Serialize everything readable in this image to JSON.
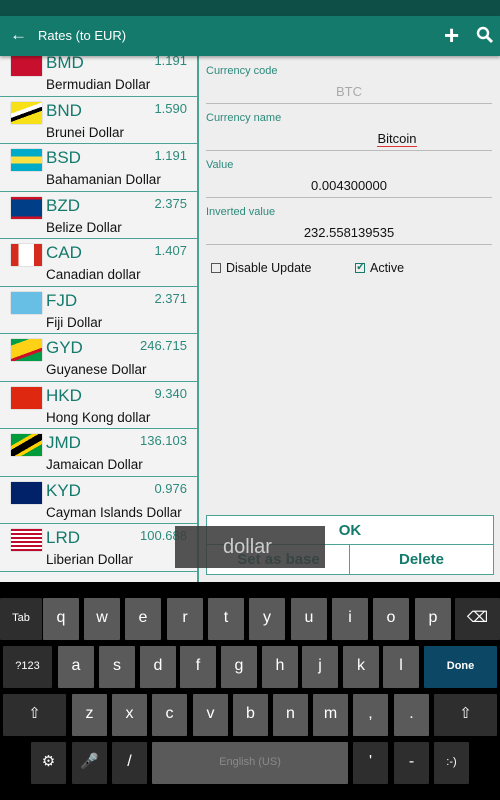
{
  "toolbar": {
    "title": "Rates (to EUR)",
    "back_icon": "arrow-left-icon",
    "add_icon": "plus-icon",
    "search_icon": "search-icon"
  },
  "colors": {
    "primary": "#137a6c",
    "status_bar": "#0e4f48",
    "accent_text": "#2c8a7c",
    "done_key": "#0c4866"
  },
  "currencies": [
    {
      "code": "BMD",
      "rate": "1.191",
      "name": "Bermudian Dollar"
    },
    {
      "code": "BND",
      "rate": "1.590",
      "name": "Brunei Dollar"
    },
    {
      "code": "BSD",
      "rate": "1.191",
      "name": "Bahamanian Dollar"
    },
    {
      "code": "BZD",
      "rate": "2.375",
      "name": "Belize Dollar"
    },
    {
      "code": "CAD",
      "rate": "1.407",
      "name": "Canadian dollar"
    },
    {
      "code": "FJD",
      "rate": "2.371",
      "name": "Fiji Dollar"
    },
    {
      "code": "GYD",
      "rate": "246.715",
      "name": "Guyanese Dollar"
    },
    {
      "code": "HKD",
      "rate": "9.340",
      "name": "Hong Kong dollar"
    },
    {
      "code": "JMD",
      "rate": "136.103",
      "name": "Jamaican Dollar"
    },
    {
      "code": "KYD",
      "rate": "0.976",
      "name": "Cayman Islands Dollar"
    },
    {
      "code": "LRD",
      "rate": "100.688",
      "name": "Liberian Dollar"
    }
  ],
  "detail": {
    "code_label": "Currency code",
    "code_value": "BTC",
    "name_label": "Currency name",
    "name_value": "Bitcoin",
    "value_label": "Value",
    "value_value": "0.004300000",
    "inverted_label": "Inverted value",
    "inverted_value": "232.558139535",
    "disable_update": "Disable Update",
    "disable_update_checked": false,
    "active": "Active",
    "active_checked": true,
    "ok": "OK",
    "set_base": "Set as base",
    "delete": "Delete"
  },
  "toast": "dollar",
  "keyboard": {
    "row1": [
      "Tab",
      "q",
      "w",
      "e",
      "r",
      "t",
      "y",
      "u",
      "i",
      "o",
      "p",
      "⌫"
    ],
    "row2": [
      "?123",
      "a",
      "s",
      "d",
      "f",
      "g",
      "h",
      "j",
      "k",
      "l",
      "Done"
    ],
    "row3": [
      "⇧",
      "z",
      "x",
      "c",
      "v",
      "b",
      "n",
      "m",
      ",",
      ".",
      "⇧"
    ],
    "row4": [
      "⚙",
      "🎤",
      "/",
      "English (US)",
      "'",
      "-",
      ":-)"
    ]
  }
}
